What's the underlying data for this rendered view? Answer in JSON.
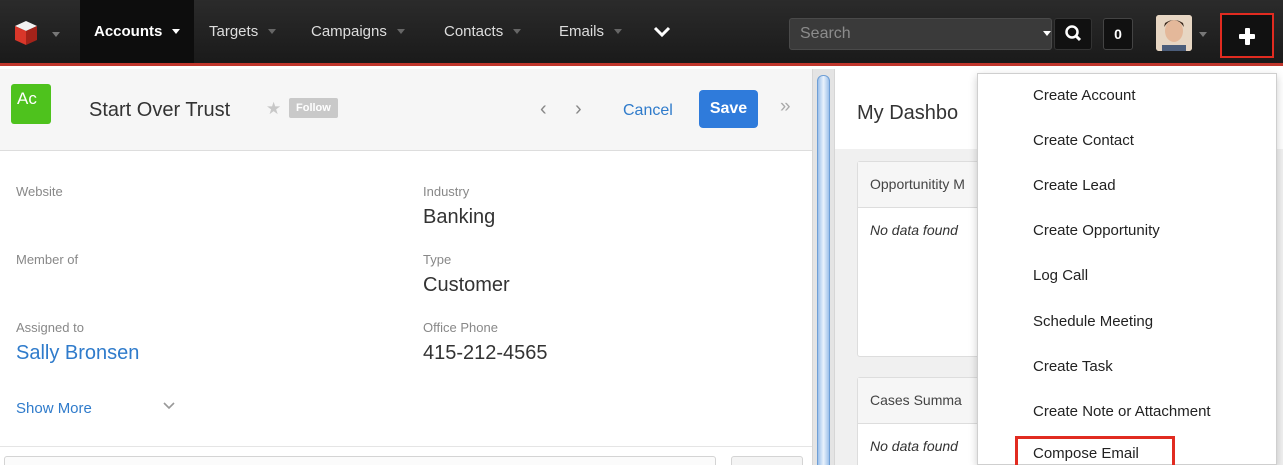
{
  "topnav": {
    "items": [
      {
        "label": "Accounts"
      },
      {
        "label": "Targets"
      },
      {
        "label": "Campaigns"
      },
      {
        "label": "Contacts"
      },
      {
        "label": "Emails"
      }
    ],
    "search_placeholder": "Search",
    "notification_count": "0",
    "accent_color": "#c0362c",
    "highlight_color": "#e12b20"
  },
  "record": {
    "module_badge": "Ac",
    "name": "Start Over Trust",
    "follow_label": "Follow",
    "cancel_label": "Cancel",
    "save_label": "Save",
    "fields": {
      "website_label": "Website",
      "industry_label": "Industry",
      "industry_value": "Banking",
      "member_of_label": "Member of",
      "type_label": "Type",
      "type_value": "Customer",
      "assigned_to_label": "Assigned to",
      "assigned_to_value": "Sally Bronsen",
      "office_phone_label": "Office Phone",
      "office_phone_value": "415-212-4565"
    },
    "show_more_label": "Show More"
  },
  "dashboard": {
    "title": "My Dashbo",
    "dashlets": [
      {
        "title": "Opportunitity M",
        "body": "No data found"
      },
      {
        "title": "Cases Summa",
        "body": "No data found"
      }
    ]
  },
  "quick_create_menu": {
    "items": [
      {
        "label": "Create Account"
      },
      {
        "label": "Create Contact"
      },
      {
        "label": "Create Lead"
      },
      {
        "label": "Create Opportunity"
      },
      {
        "label": "Log Call"
      },
      {
        "label": "Schedule Meeting"
      },
      {
        "label": "Create Task"
      },
      {
        "label": "Create Note or Attachment"
      },
      {
        "label": "Compose Email"
      }
    ]
  }
}
